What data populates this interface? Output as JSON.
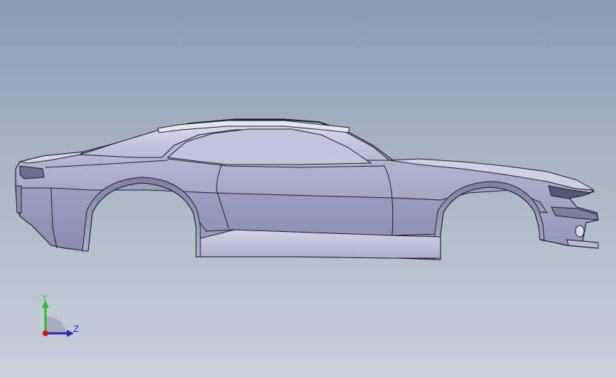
{
  "viewport": {
    "background_top": "#8a9bb0",
    "background_bottom": "#c9d0da",
    "model": {
      "description_icon": "car-body-shell",
      "face_color": "#aeb1cf",
      "edge_color": "#1c1c28"
    }
  },
  "triad": {
    "y_label": "Y",
    "z_label": "Z",
    "x_color": "#e01010",
    "y_color": "#21c021",
    "z_color": "#2424c8"
  }
}
